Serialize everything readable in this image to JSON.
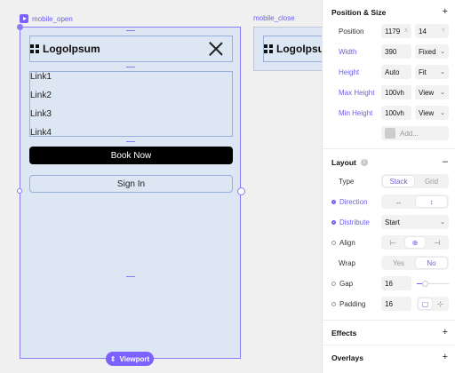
{
  "canvas": {
    "frame_open_label": "mobile_open",
    "frame_close_label": "mobile_close",
    "logo_text": "LogoIpsum",
    "links": [
      "Link1",
      "Link2",
      "Link3",
      "Link4"
    ],
    "primary_button": "Book Now",
    "secondary_button": "Sign In",
    "viewport_label": "Viewport"
  },
  "panel": {
    "position_size": {
      "title": "Position & Size",
      "position_label": "Position",
      "position_x": "1179",
      "position_x_suffix": "X",
      "position_y": "14",
      "position_y_suffix": "Y",
      "width_label": "Width",
      "width_value": "390",
      "width_mode": "Fixed",
      "height_label": "Height",
      "height_value": "Auto",
      "height_mode": "Fit",
      "max_height_label": "Max Height",
      "max_height_value": "100vh",
      "max_height_mode": "View",
      "min_height_label": "Min Height",
      "min_height_value": "100vh",
      "min_height_mode": "View",
      "add_placeholder": "Add..."
    },
    "layout": {
      "title": "Layout",
      "type_label": "Type",
      "type_options": [
        "Stack",
        "Grid"
      ],
      "direction_label": "Direction",
      "distribute_label": "Distribute",
      "distribute_value": "Start",
      "align_label": "Align",
      "wrap_label": "Wrap",
      "wrap_options": [
        "Yes",
        "No"
      ],
      "gap_label": "Gap",
      "gap_value": "16",
      "padding_label": "Padding",
      "padding_value": "16"
    },
    "effects_title": "Effects",
    "overlays_title": "Overlays"
  },
  "colors": {
    "accent": "#7b61ff",
    "frame_bg": "#dde6f3",
    "button_primary": "#000000"
  }
}
